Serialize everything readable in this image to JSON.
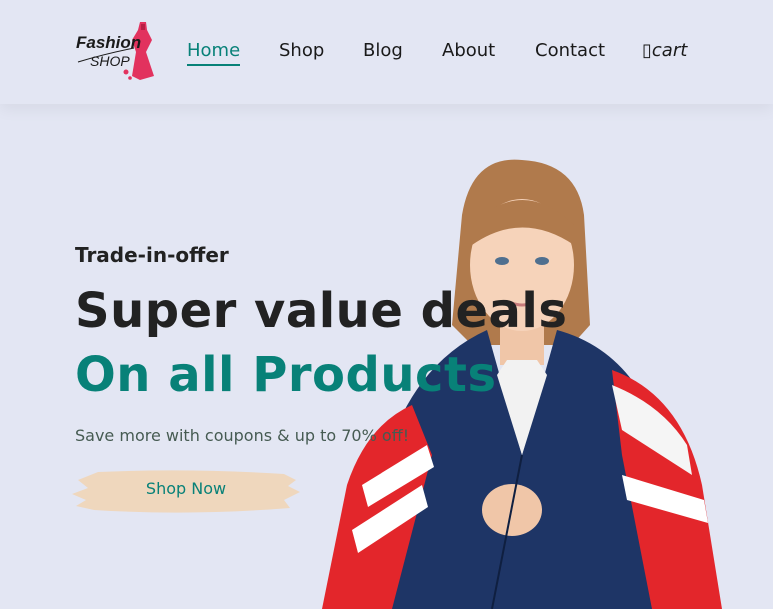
{
  "brand": {
    "logo_line1": "Fashion",
    "logo_line2": "SHOP"
  },
  "nav": {
    "items": [
      {
        "label": "Home",
        "active": true
      },
      {
        "label": "Shop"
      },
      {
        "label": "Blog"
      },
      {
        "label": "About"
      },
      {
        "label": "Contact"
      }
    ],
    "cart_glyph": "▯",
    "cart_label": "cart"
  },
  "hero": {
    "eyebrow": "Trade-in-offer",
    "headline": "Super value deals",
    "headline_accent": "On all Products",
    "subtitle": "Save more with coupons & up to 70% off!",
    "cta_label": "Shop Now"
  },
  "colors": {
    "background": "#e3e6f3",
    "accent": "#088178",
    "cta_brush": "#efd7bd",
    "text_dark": "#222222"
  }
}
